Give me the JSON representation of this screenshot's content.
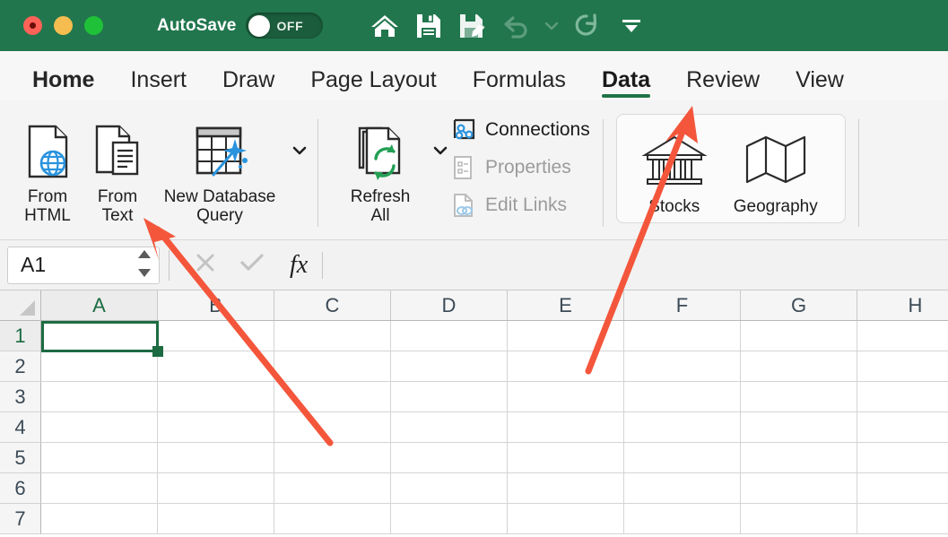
{
  "window": {
    "titlebar": {
      "autosave_label": "AutoSave",
      "autosave_state": "OFF",
      "traffic_lights": [
        "close",
        "minimize",
        "zoom"
      ],
      "quick_access": [
        {
          "name": "home-icon",
          "label": "Home"
        },
        {
          "name": "save-icon",
          "label": "Save"
        },
        {
          "name": "save-as-icon",
          "label": "Save As"
        },
        {
          "name": "undo-icon",
          "label": "Undo",
          "disabled": true
        },
        {
          "name": "undo-dropdown-icon",
          "label": "Undo History",
          "disabled": true
        },
        {
          "name": "redo-icon",
          "label": "Redo"
        },
        {
          "name": "customize-toolbar-icon",
          "label": "Customize Toolbar"
        }
      ],
      "bar_color": "#21764d"
    }
  },
  "ribbon": {
    "tabs": [
      {
        "label": "Home",
        "bold": true,
        "active": false
      },
      {
        "label": "Insert",
        "bold": false,
        "active": false
      },
      {
        "label": "Draw",
        "bold": false,
        "active": false
      },
      {
        "label": "Page Layout",
        "bold": false,
        "active": false
      },
      {
        "label": "Formulas",
        "bold": false,
        "active": false
      },
      {
        "label": "Data",
        "bold": true,
        "active": true
      },
      {
        "label": "Review",
        "bold": false,
        "active": false
      },
      {
        "label": "View",
        "bold": false,
        "active": false
      }
    ],
    "active_tab": "Data",
    "accent_color": "#217346",
    "groups": {
      "get_external_data": {
        "buttons": [
          {
            "label_line1": "From",
            "label_line2": "HTML",
            "icon": "document-globe-icon"
          },
          {
            "label_line1": "From",
            "label_line2": "Text",
            "icon": "document-text-icon"
          },
          {
            "label_line1": "New Database",
            "label_line2": "Query",
            "icon": "table-wand-icon",
            "has_dropdown": true
          }
        ]
      },
      "connections": {
        "refresh": {
          "label_line1": "Refresh",
          "label_line2": "All",
          "icon": "refresh-all-icon",
          "has_dropdown": true
        },
        "commands": [
          {
            "label": "Connections",
            "icon": "connections-icon",
            "disabled": false
          },
          {
            "label": "Properties",
            "icon": "properties-icon",
            "disabled": true
          },
          {
            "label": "Edit Links",
            "icon": "edit-links-icon",
            "disabled": true
          }
        ]
      },
      "data_types": {
        "buttons": [
          {
            "label": "Stocks",
            "icon": "bank-building-icon"
          },
          {
            "label": "Geography",
            "icon": "folded-map-icon"
          }
        ]
      }
    }
  },
  "formula_bar": {
    "name_box_value": "A1",
    "cancel_icon": "cancel-x-icon",
    "enter_icon": "checkmark-icon",
    "function_icon": "fx-icon",
    "formula_value": "",
    "formula_placeholder": ""
  },
  "sheet": {
    "columns": [
      "A",
      "B",
      "C",
      "D",
      "E",
      "F",
      "G",
      "H"
    ],
    "rows": [
      "1",
      "2",
      "3",
      "4",
      "5",
      "6",
      "7"
    ],
    "selected_cell": "A1",
    "selected_column": "A",
    "selected_row": "1",
    "selection_color": "#1d6b42",
    "cell_values": {}
  },
  "annotations": {
    "color": "#f4563c",
    "arrows": [
      {
        "name": "arrow-to-from-text",
        "target": "From Text"
      },
      {
        "name": "arrow-to-stocks",
        "target": "Stocks"
      }
    ]
  }
}
